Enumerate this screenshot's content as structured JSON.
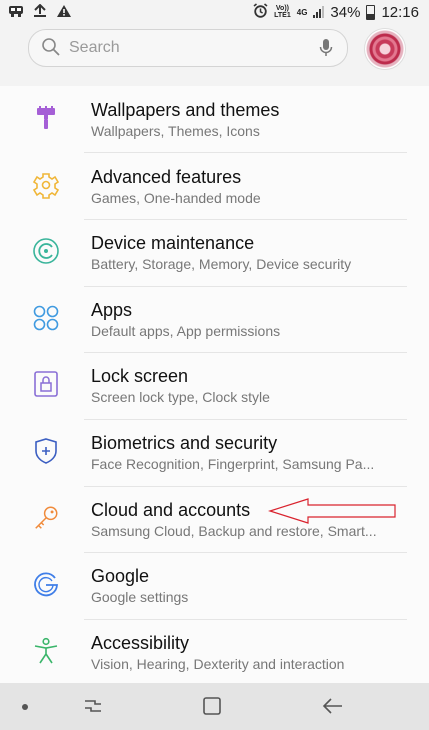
{
  "status_bar": {
    "carrier_top": "Vo))",
    "carrier_bottom": "LTE1",
    "network_type": "4G",
    "battery_percent": "34%",
    "time": "12:16",
    "icons": [
      "app-icon",
      "upload-icon",
      "warning-icon",
      "alarm-icon",
      "vibrate-icon",
      "signal-icon",
      "battery-icon"
    ]
  },
  "search": {
    "placeholder": "Search"
  },
  "settings": [
    {
      "title": "Wallpapers and themes",
      "subtitle": "Wallpapers, Themes, Icons",
      "icon": "paint-roller-icon",
      "color": "#a55fd6"
    },
    {
      "title": "Advanced features",
      "subtitle": "Games, One-handed mode",
      "icon": "puzzle-gear-icon",
      "color": "#f0b638"
    },
    {
      "title": "Device maintenance",
      "subtitle": "Battery, Storage, Memory, Device security",
      "icon": "maintenance-icon",
      "color": "#3ab59b"
    },
    {
      "title": "Apps",
      "subtitle": "Default apps, App permissions",
      "icon": "apps-icon",
      "color": "#3f9ae0"
    },
    {
      "title": "Lock screen",
      "subtitle": "Screen lock type, Clock style",
      "icon": "lock-icon",
      "color": "#8a6fd6"
    },
    {
      "title": "Biometrics and security",
      "subtitle": "Face Recognition, Fingerprint, Samsung Pa...",
      "icon": "shield-icon",
      "color": "#3c5fc2"
    },
    {
      "title": "Cloud and accounts",
      "subtitle": "Samsung Cloud, Backup and restore, Smart...",
      "icon": "key-icon",
      "color": "#f08a3a"
    },
    {
      "title": "Google",
      "subtitle": "Google settings",
      "icon": "google-icon",
      "color": "#3f7ee8"
    },
    {
      "title": "Accessibility",
      "subtitle": "Vision, Hearing, Dexterity and interaction",
      "icon": "accessibility-icon",
      "color": "#3ab56a"
    }
  ],
  "colors": {
    "annotation_arrow": "#d9232e",
    "background": "#fbfbfb",
    "navbar": "#e4e4e4"
  },
  "navigation": [
    "dot-icon",
    "recent-apps-icon",
    "home-icon",
    "back-icon"
  ]
}
